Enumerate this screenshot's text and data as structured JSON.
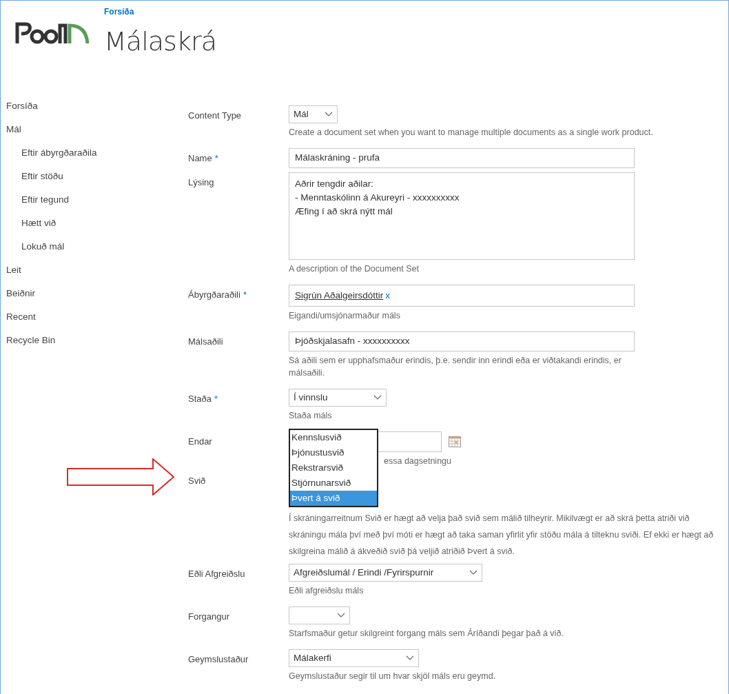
{
  "header": {
    "breadcrumb": "Forsíða",
    "title": "Málaskrá"
  },
  "sidebar": {
    "items": [
      {
        "label": "Forsíða"
      },
      {
        "label": "Mál",
        "children": [
          {
            "label": "Eftir ábyrgðaraðila"
          },
          {
            "label": "Eftir stöðu"
          },
          {
            "label": "Eftir tegund"
          },
          {
            "label": "Hætt við"
          },
          {
            "label": "Lokuð mál"
          }
        ]
      },
      {
        "label": "Leit"
      },
      {
        "label": "Beiðnir"
      },
      {
        "label": "Recent"
      },
      {
        "label": "Recycle Bin"
      }
    ]
  },
  "form": {
    "fields": [
      {
        "kind": "select",
        "label": "Content Type",
        "value": "Mál",
        "help": "Create a document set when you want to manage multiple documents as a single work product."
      },
      {
        "kind": "text",
        "label": "Name",
        "required_mark": "*",
        "value": "Málaskráning - prufa"
      },
      {
        "kind": "textarea",
        "label": "Lýsing",
        "value": "Aðrir tengdir aðilar:\n- Menntaskólinn á Akureyri - xxxxxxxxxx\nÆfing í að skrá nýtt mál",
        "help": "A description of the Document Set"
      },
      {
        "kind": "people",
        "label": "Ábyrgðaraðili",
        "required_mark": "*",
        "value": "Sigrún Aðalgeirsdóttir",
        "remove": "x",
        "help": "Eigandi/umsjónarmaður máls"
      },
      {
        "kind": "text",
        "label": "Málsaðili",
        "value": "Þjóðskjalasafn - xxxxxxxxxx",
        "help": "Sá aðili sem er upphafsmaður erindis, þ.e. sendir inn erindi eða er viðtakandi erindis, er málsaðili."
      },
      {
        "kind": "select",
        "label": "Staða",
        "required_mark": "*",
        "value": "Í vinnslu",
        "help": "Staða máls"
      },
      {
        "kind": "date",
        "label": "Endar",
        "help": "essa dagsetningu"
      },
      {
        "kind": "open_select",
        "label": "Svið",
        "arrow": true,
        "options": [
          {
            "label": "Kennslusvið",
            "selected": false
          },
          {
            "label": "Þjónustusvið",
            "selected": false
          },
          {
            "label": "Rekstrarsvið",
            "selected": false
          },
          {
            "label": "Stjórnunarsvið",
            "selected": false
          },
          {
            "label": "Þvert á svið",
            "selected": true
          }
        ],
        "help": "Í skráningarreitnum Svið er hægt að velja það svið sem málið tilheyrir. Mikilvægt er að skrá þetta atriði við skráningu mála því með því móti er hægt að taka saman yfirlit yfir stöðu mála á tilteknu sviði. Ef ekki er hægt að skilgreina málið á ákveðið svið þá veljið atriðið Þvert á svið."
      },
      {
        "kind": "select",
        "label": "Eðli Afgreiðslu",
        "value": "Afgreiðslumál / Erindi /Fyrirspurnir",
        "help": "Eðli afgreiðslu máls"
      },
      {
        "kind": "select",
        "label": "Forgangur",
        "help": "Starfsmaður getur skilgreint forgang máls sem Áríðandi þegar það á við."
      },
      {
        "kind": "select",
        "label": "Geymslustaður",
        "value": "Málakerfi",
        "help": "Geymslustaður segir til um hvar skjöl máls eru geymd."
      }
    ]
  }
}
